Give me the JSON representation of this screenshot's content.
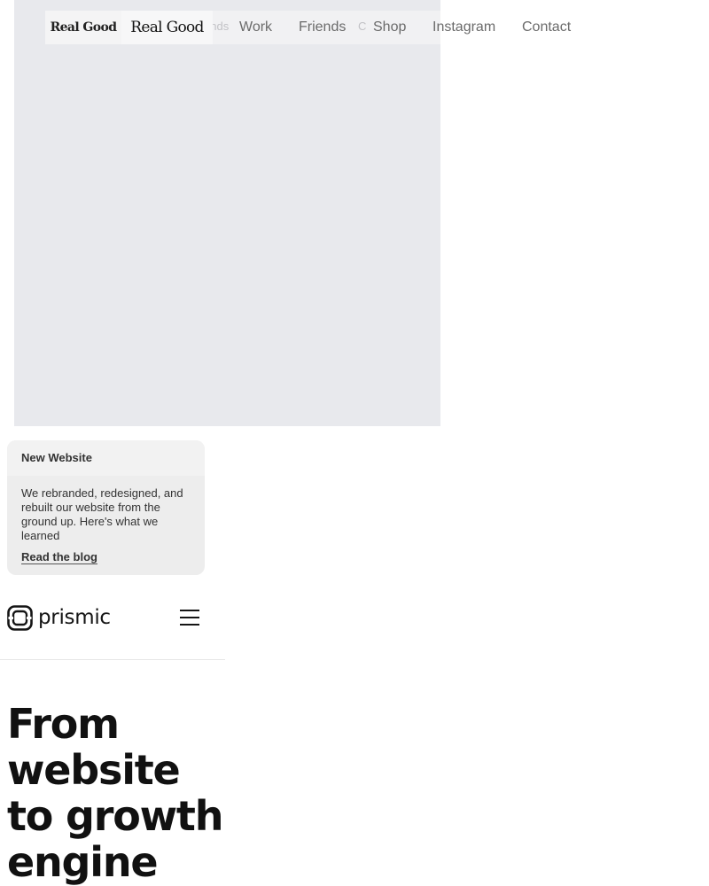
{
  "realgood": {
    "logo_small": "Real Good",
    "logo_large": "Real Good",
    "ghost_nav": [
      "ends",
      "",
      "C"
    ],
    "nav": [
      "Work",
      "Friends",
      "Shop",
      "Instagram",
      "Contact"
    ],
    "colors": {
      "panel": "#e8e9ed",
      "nav_text": "#6b6b6b"
    }
  },
  "announcement": {
    "title": "New Website",
    "body": "We rebranded, redesigned, and rebuilt our website from the ground up. Here's what we learned",
    "link": "Read the blog"
  },
  "header": {
    "logo_text": "prismic",
    "logo_icon": "prismic-logo-icon",
    "menu_icon": "hamburger-menu-icon"
  },
  "hero": {
    "heading": "From website to growth engine"
  }
}
